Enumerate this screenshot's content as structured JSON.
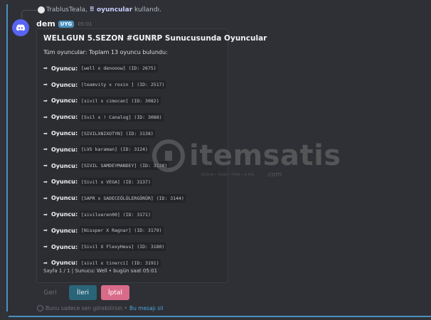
{
  "reply": {
    "username": "TrablusTeala",
    "command": "oyuncular",
    "suffix": "kullandı"
  },
  "message": {
    "author": "dem",
    "badge": "UYG",
    "timestamp": "05:01"
  },
  "embed": {
    "title": "WELLGUN 5.SEZON #GUNRP Sunucusunda Oyuncular",
    "description": "Tüm oyuncular: Toplam 13 oyuncu bulundu:",
    "player_label": "Oyuncu:",
    "players": [
      "[well x denooow] (ID: 2675)",
      "[teamvity x  roxin ] (ID: 2517)",
      "[sivil x cimocan] (ID: 3082)",
      "[Svil x ! Canalog] (ID: 3088)",
      "[SIVILXNIXOTYN] (ID: 3138)",
      "[LVS karaman] (ID: 3124)",
      "[SIVIL SAMDEYMANDEY] (ID: 3128)",
      "[Sivil x VEGA] (ID: 3137)",
      "[SAPR x SADECEÖLÜLERGÖRÜR] (ID: 3144)",
      "[sivilxeren00] (ID: 3171)",
      "[Nissper X Ragnar] (ID: 3179)",
      "[Sivil X FlexyHeus] (ID: 3180)",
      "[sivil x tinerci] (ID: 3191)"
    ],
    "footer": "Sayfa 1 / 1 | Sunucu: Well • bugün saat 05:01"
  },
  "buttons": {
    "back": "Geri",
    "next": "İleri",
    "cancel": "İptal"
  },
  "ephemeral": {
    "note": "Bunu sadece sen görebilirsin •",
    "delete_link": "Bu mesajı sil"
  },
  "watermark": {
    "brand": "itemsatis",
    "domain": ".com",
    "tagline": "DESAN • OAIN • ITEM • E-PIN"
  },
  "colors": {
    "accent": "#4a8fbf",
    "next_button": "#2a6478",
    "cancel_button": "#d96b8a",
    "link": "#4aa3df"
  },
  "icons": {
    "avatar": "discord-logo-icon",
    "ephemeral": "eye-icon",
    "player_bullet": "arrow-right-icon"
  }
}
